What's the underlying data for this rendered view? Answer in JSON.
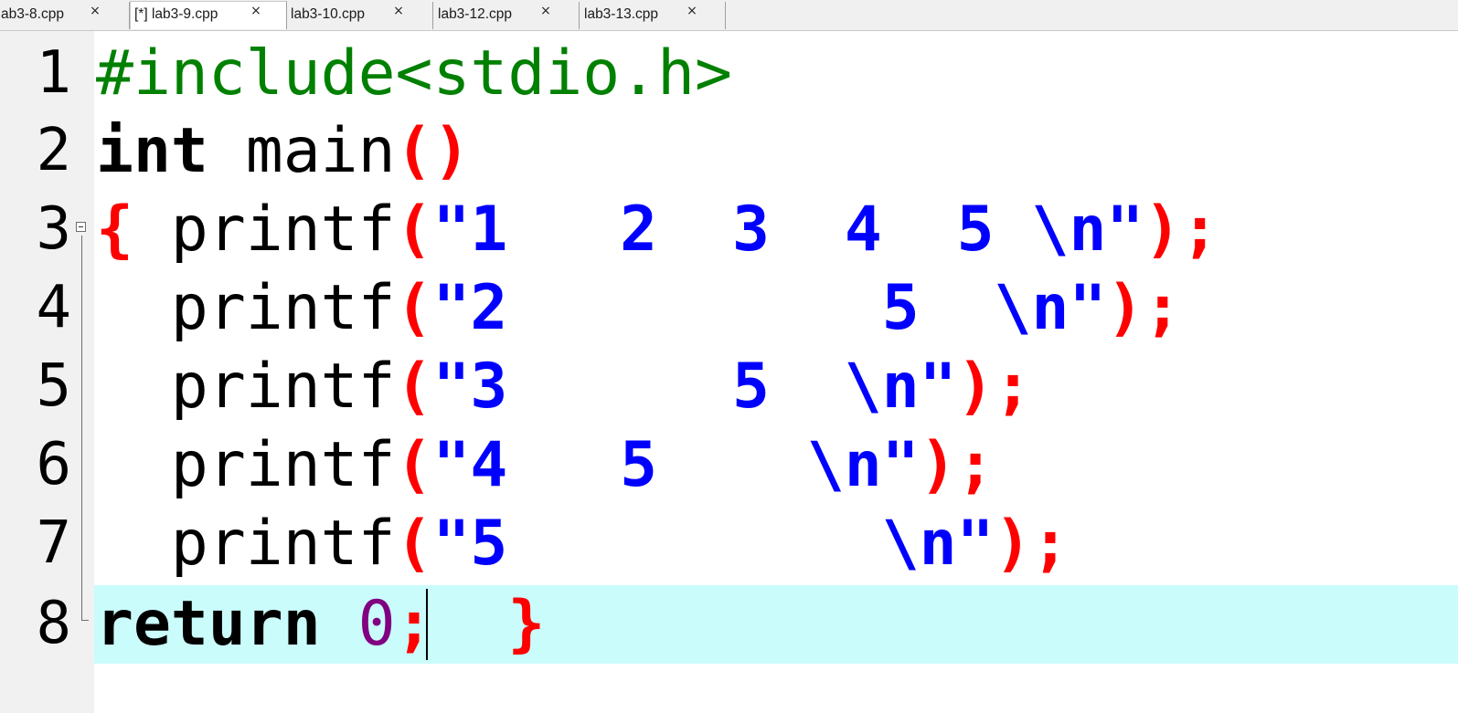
{
  "tabs": [
    {
      "label": "ab3-8.cpp",
      "close": "×",
      "active": false
    },
    {
      "label": "[*] lab3-9.cpp",
      "close": "×",
      "active": true
    },
    {
      "label": "lab3-10.cpp",
      "close": "×",
      "active": false
    },
    {
      "label": "lab3-12.cpp",
      "close": "×",
      "active": false
    },
    {
      "label": "lab3-13.cpp",
      "close": "×",
      "active": false
    }
  ],
  "editor": {
    "line_numbers": [
      "1",
      "2",
      "3",
      "4",
      "5",
      "6",
      "7",
      "8"
    ],
    "current_line": 8,
    "lines": [
      [
        {
          "t": "#include<stdio.h>",
          "c": "pp"
        }
      ],
      [
        {
          "t": "int",
          "c": "kw"
        },
        {
          "t": " main",
          "c": "id"
        },
        {
          "t": "()",
          "c": "op"
        }
      ],
      [
        {
          "t": "{",
          "c": "op"
        },
        {
          "t": " printf",
          "c": "id"
        },
        {
          "t": "(",
          "c": "op"
        },
        {
          "t": "\"1   2  3  4  5 \\n\"",
          "c": "str"
        },
        {
          "t": ");",
          "c": "op"
        }
      ],
      [
        {
          "t": "  printf",
          "c": "id"
        },
        {
          "t": "(",
          "c": "op"
        },
        {
          "t": "\"2          5  \\n\"",
          "c": "str"
        },
        {
          "t": ");",
          "c": "op"
        }
      ],
      [
        {
          "t": "  printf",
          "c": "id"
        },
        {
          "t": "(",
          "c": "op"
        },
        {
          "t": "\"3      5  \\n\"",
          "c": "str"
        },
        {
          "t": ");",
          "c": "op"
        }
      ],
      [
        {
          "t": "  printf",
          "c": "id"
        },
        {
          "t": "(",
          "c": "op"
        },
        {
          "t": "\"4   5    \\n\"",
          "c": "str"
        },
        {
          "t": ");",
          "c": "op"
        }
      ],
      [
        {
          "t": "  printf",
          "c": "id"
        },
        {
          "t": "(",
          "c": "op"
        },
        {
          "t": "\"5          \\n\"",
          "c": "str"
        },
        {
          "t": ");",
          "c": "op"
        }
      ],
      [
        {
          "t": "return",
          "c": "kw"
        },
        {
          "t": " ",
          "c": "id"
        },
        {
          "t": "0",
          "c": "num"
        },
        {
          "t": ";",
          "c": "op"
        },
        {
          "t": "  ",
          "c": "id"
        },
        {
          "t": "}",
          "c": "op"
        }
      ]
    ]
  },
  "colors": {
    "preprocessor": "#008000",
    "keyword": "#000000",
    "operator": "#ff0000",
    "string": "#0000ff",
    "number": "#800080",
    "current_line_bg": "#cafcfc",
    "gutter_bg": "#f1f1f1"
  }
}
